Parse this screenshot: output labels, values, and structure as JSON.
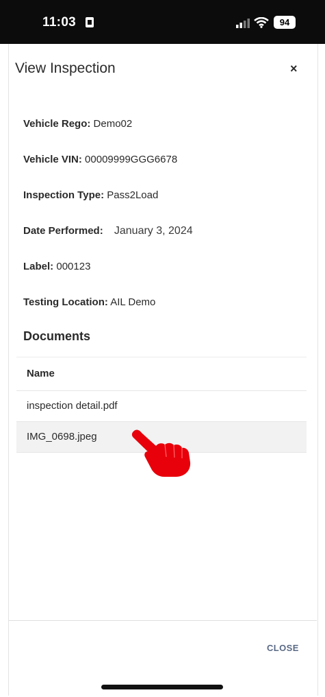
{
  "status_bar": {
    "time": "11:03",
    "battery": "94"
  },
  "dialog": {
    "title": "View Inspection",
    "close_symbol": "×",
    "fields": {
      "rego_label": "Vehicle Rego:",
      "rego_value": "Demo02",
      "vin_label": "Vehicle VIN:",
      "vin_value": "00009999GGG6678",
      "type_label": "Inspection Type:",
      "type_value": "Pass2Load",
      "date_label": "Date Performed:",
      "date_value": "January 3, 2024",
      "label_label": "Label:",
      "label_value": "000123",
      "location_label": "Testing Location:",
      "location_value": "AIL Demo"
    },
    "documents": {
      "heading": "Documents",
      "column_name": "Name",
      "rows": [
        "inspection detail.pdf",
        "IMG_0698.jpeg"
      ]
    },
    "close_button": "CLOSE"
  },
  "icons": {
    "pointer": "pointing-hand-icon",
    "pointer_color": "#e8000b"
  }
}
